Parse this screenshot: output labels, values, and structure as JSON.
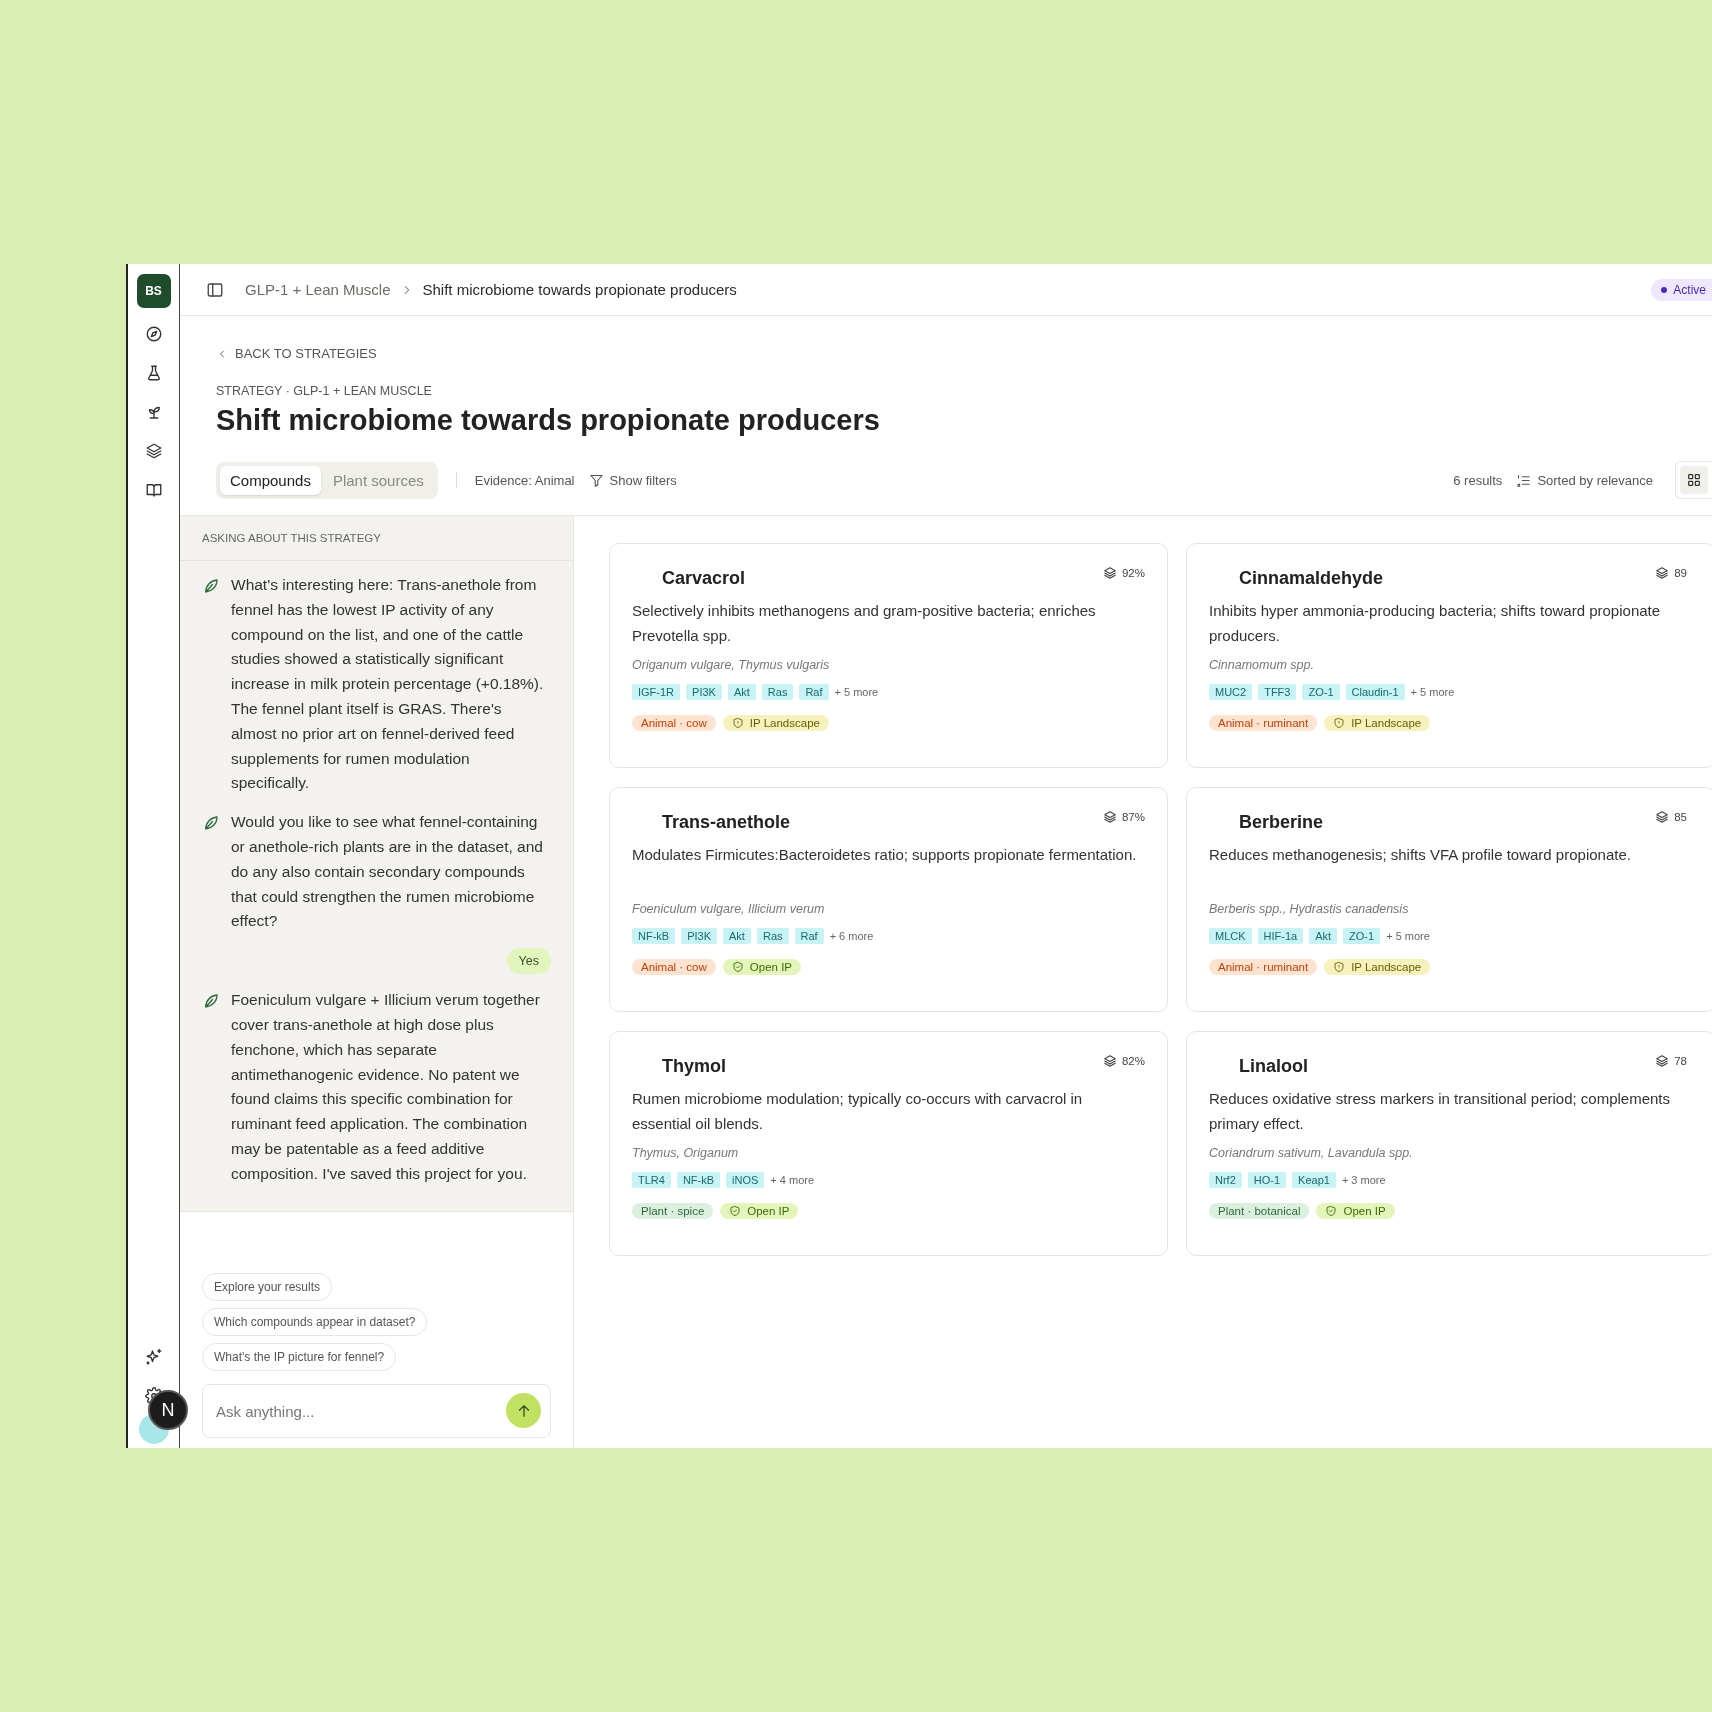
{
  "rail": {
    "logo": "BS"
  },
  "breadcrumb": [
    "GLP-1 + Lean Muscle",
    "Shift microbiome towards propionate producers"
  ],
  "status_badge": "Active",
  "back_link": "BACK TO STRATEGIES",
  "eyebrow": "STRATEGY · GLP-1 + LEAN MUSCLE",
  "title": "Shift microbiome towards propionate producers",
  "tabs": [
    {
      "label": "Compounds",
      "selected": true
    },
    {
      "label": "Plant sources",
      "selected": false
    }
  ],
  "evidence": "Evidence: Animal",
  "filters_button": "Show filters",
  "results_count": "6 results",
  "sort_button": "Sorted by relevance",
  "chat": {
    "heading": "ASKING ABOUT THIS STRATEGY",
    "messages": [
      {
        "kind": "assistant",
        "text": "What's interesting here: Trans-anethole from fennel has the lowest IP activity of any compound on the list, and one of the cattle studies showed a statistically significant increase in milk protein percentage (+0.18%). The fennel plant itself is GRAS. There's almost no prior art on fennel-derived feed supplements for rumen modulation specifically."
      },
      {
        "kind": "assistant",
        "text": "Would you like to see what fennel-containing or anethole-rich plants are in the dataset, and do any also contain secondary compounds that could strengthen the rumen microbiome effect?"
      },
      {
        "kind": "user",
        "text": "Yes"
      },
      {
        "kind": "assistant",
        "text": "Foeniculum vulgare + Illicium verum together cover trans-anethole at high dose plus fenchone, which has separate antimethanogenic evidence. No patent we found claims this specific combination for ruminant feed application. The combination may be patentable as a feed additive composition. I've saved this project for you."
      }
    ],
    "suggestions": [
      "Explore your results",
      "Which compounds appear in dataset?",
      "What's the IP picture for fennel?"
    ],
    "input": {
      "placeholder": "Ask anything..."
    }
  },
  "dev_badge": "N",
  "cards": [
    {
      "name": "Carvacrol",
      "score": "92%",
      "description": "Selectively inhibits methanogens and gram-positive bacteria; enriches Prevotella spp.",
      "sources": "Origanum vulgare, Thymus vulgaris",
      "targets": [
        "IGF-1R",
        "PI3K",
        "Akt",
        "Ras",
        "Raf"
      ],
      "more": "+ 5 more",
      "source_tag": {
        "kind": "animal",
        "label": "Animal · cow"
      },
      "ip_tag": {
        "kind": "landscape",
        "label": "IP Landscape"
      }
    },
    {
      "name": "Cinnamaldehyde",
      "score": "89",
      "description": "Inhibits hyper ammonia-producing bacteria; shifts toward propionate producers.",
      "sources": "Cinnamomum spp.",
      "targets": [
        "MUC2",
        "TFF3",
        "ZO-1",
        "Claudin-1"
      ],
      "more": "+ 5 more",
      "source_tag": {
        "kind": "animal",
        "label": "Animal · ruminant"
      },
      "ip_tag": {
        "kind": "landscape",
        "label": "IP Landscape"
      }
    },
    {
      "name": "Trans-anethole",
      "score": "87%",
      "description": "Modulates Firmicutes:Bacteroidetes ratio; supports propionate fermentation.",
      "sources": "Foeniculum vulgare, Illicium verum",
      "targets": [
        "NF-kB",
        "PI3K",
        "Akt",
        "Ras",
        "Raf"
      ],
      "more": "+ 6 more",
      "source_tag": {
        "kind": "animal",
        "label": "Animal · cow"
      },
      "ip_tag": {
        "kind": "open",
        "label": "Open IP"
      }
    },
    {
      "name": "Berberine",
      "score": "85",
      "description": "Reduces methanogenesis; shifts VFA profile toward propionate.",
      "sources": "Berberis spp., Hydrastis canadensis",
      "targets": [
        "MLCK",
        "HIF-1a",
        "Akt",
        "ZO-1"
      ],
      "more": "+ 5 more",
      "source_tag": {
        "kind": "animal",
        "label": "Animal · ruminant"
      },
      "ip_tag": {
        "kind": "landscape",
        "label": "IP Landscape"
      }
    },
    {
      "name": "Thymol",
      "score": "82%",
      "description": "Rumen microbiome modulation; typically co-occurs with carvacrol in essential oil blends.",
      "sources": "Thymus, Origanum",
      "targets": [
        "TLR4",
        "NF-kB",
        "iNOS"
      ],
      "more": "+ 4 more",
      "source_tag": {
        "kind": "plant",
        "label": "Plant · spice"
      },
      "ip_tag": {
        "kind": "open",
        "label": "Open IP"
      }
    },
    {
      "name": "Linalool",
      "score": "78",
      "description": "Reduces oxidative stress markers in transitional period; complements primary effect.",
      "sources": "Coriandrum sativum, Lavandula spp.",
      "targets": [
        "Nrf2",
        "HO-1",
        "Keap1"
      ],
      "more": "+ 3 more",
      "source_tag": {
        "kind": "plant",
        "label": "Plant · botanical"
      },
      "ip_tag": {
        "kind": "open",
        "label": "Open IP"
      }
    }
  ]
}
